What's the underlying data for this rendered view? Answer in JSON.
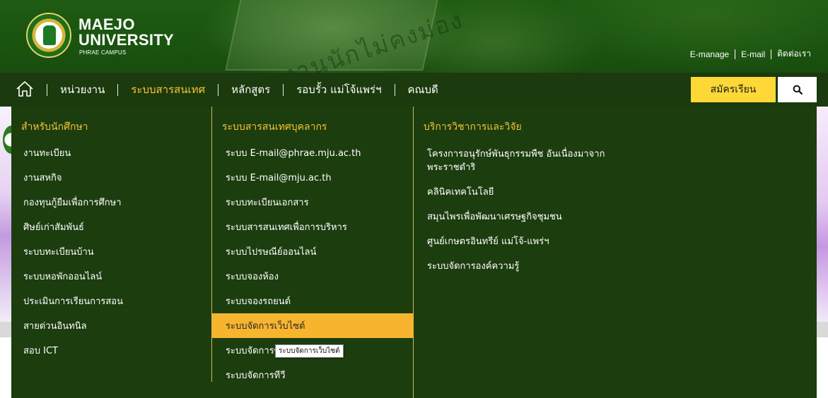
{
  "header": {
    "brand_line1": "MAEJO",
    "brand_line2": "UNIVERSITY",
    "brand_sub": "PHRAE CAMPUS",
    "sign_text": "งานนักไม่คงม่อง",
    "toplinks": [
      {
        "label": "E-manage"
      },
      {
        "label": "E-mail"
      },
      {
        "label": "ติดต่อเรา"
      }
    ]
  },
  "nav": {
    "home_icon": "home-icon",
    "items": [
      {
        "label": "หน่วยงาน",
        "active": false
      },
      {
        "label": "ระบบสารสนเทศ",
        "active": true
      },
      {
        "label": "หลักสูตร",
        "active": false
      },
      {
        "label": "รอบรั้ว แม่โจ้แพร่ฯ",
        "active": false
      },
      {
        "label": "คณบดี",
        "active": false
      }
    ],
    "apply_label": "สมัครเรียน",
    "search_icon": "search-icon"
  },
  "dropdown": {
    "col1": {
      "heading": "สำหรับนักศึกษา",
      "items": [
        "งานทะเบียน",
        "งานสหกิจ",
        "กองทุนกู้ยืมเพื่อการศึกษา",
        "ศิษย์เก่าสัมพันธ์",
        "ระบบทะเบียนบ้าน",
        "ระบบหอพักออนไลน์",
        "ประเมินการเรียนการสอน",
        "สายด่วนอินทนิล",
        "สอบ ICT"
      ]
    },
    "col2": {
      "heading": "ระบบสารสนเทศบุคลากร",
      "items": [
        "ระบบ E-mail@phrae.mju.ac.th",
        "ระบบ E-mail@mju.ac.th",
        "ระบบทะเบียนเอกสาร",
        "ระบบสารสนเทศเพื่อการบริหาร",
        "ระบบไปรษณีย์ออนไลน์",
        "ระบบจองห้อง",
        "ระบบจองรถยนต์",
        "ระบบจัดการเว็บไซต์",
        "ระบบจัดการข่",
        "ระบบจัดการทีวี"
      ],
      "hover_index": 7
    },
    "col3": {
      "heading": "บริการวิชาการและวิจัย",
      "items": [
        "โครงการอนุรักษ์พันธุกรรมพืช อันเนื่องมาจากพระราชดำริ",
        "คลินิคเทคโนโลยี",
        "สมุนไพรเพื่อพัฒนาเศรษฐกิจชุมชน",
        "ศูนย์เกษตรอินทรีย์ แม่โจ้-แพร่ฯ",
        "ระบบจัดการองค์ความรู้"
      ]
    },
    "tooltip": "ระบบจัดการเว็บไซต์"
  },
  "colors": {
    "nav_bg": "#1b3a0d",
    "accent": "#f5c237",
    "apply_btn": "#fdd836",
    "hover_bg": "#f7b42f"
  }
}
